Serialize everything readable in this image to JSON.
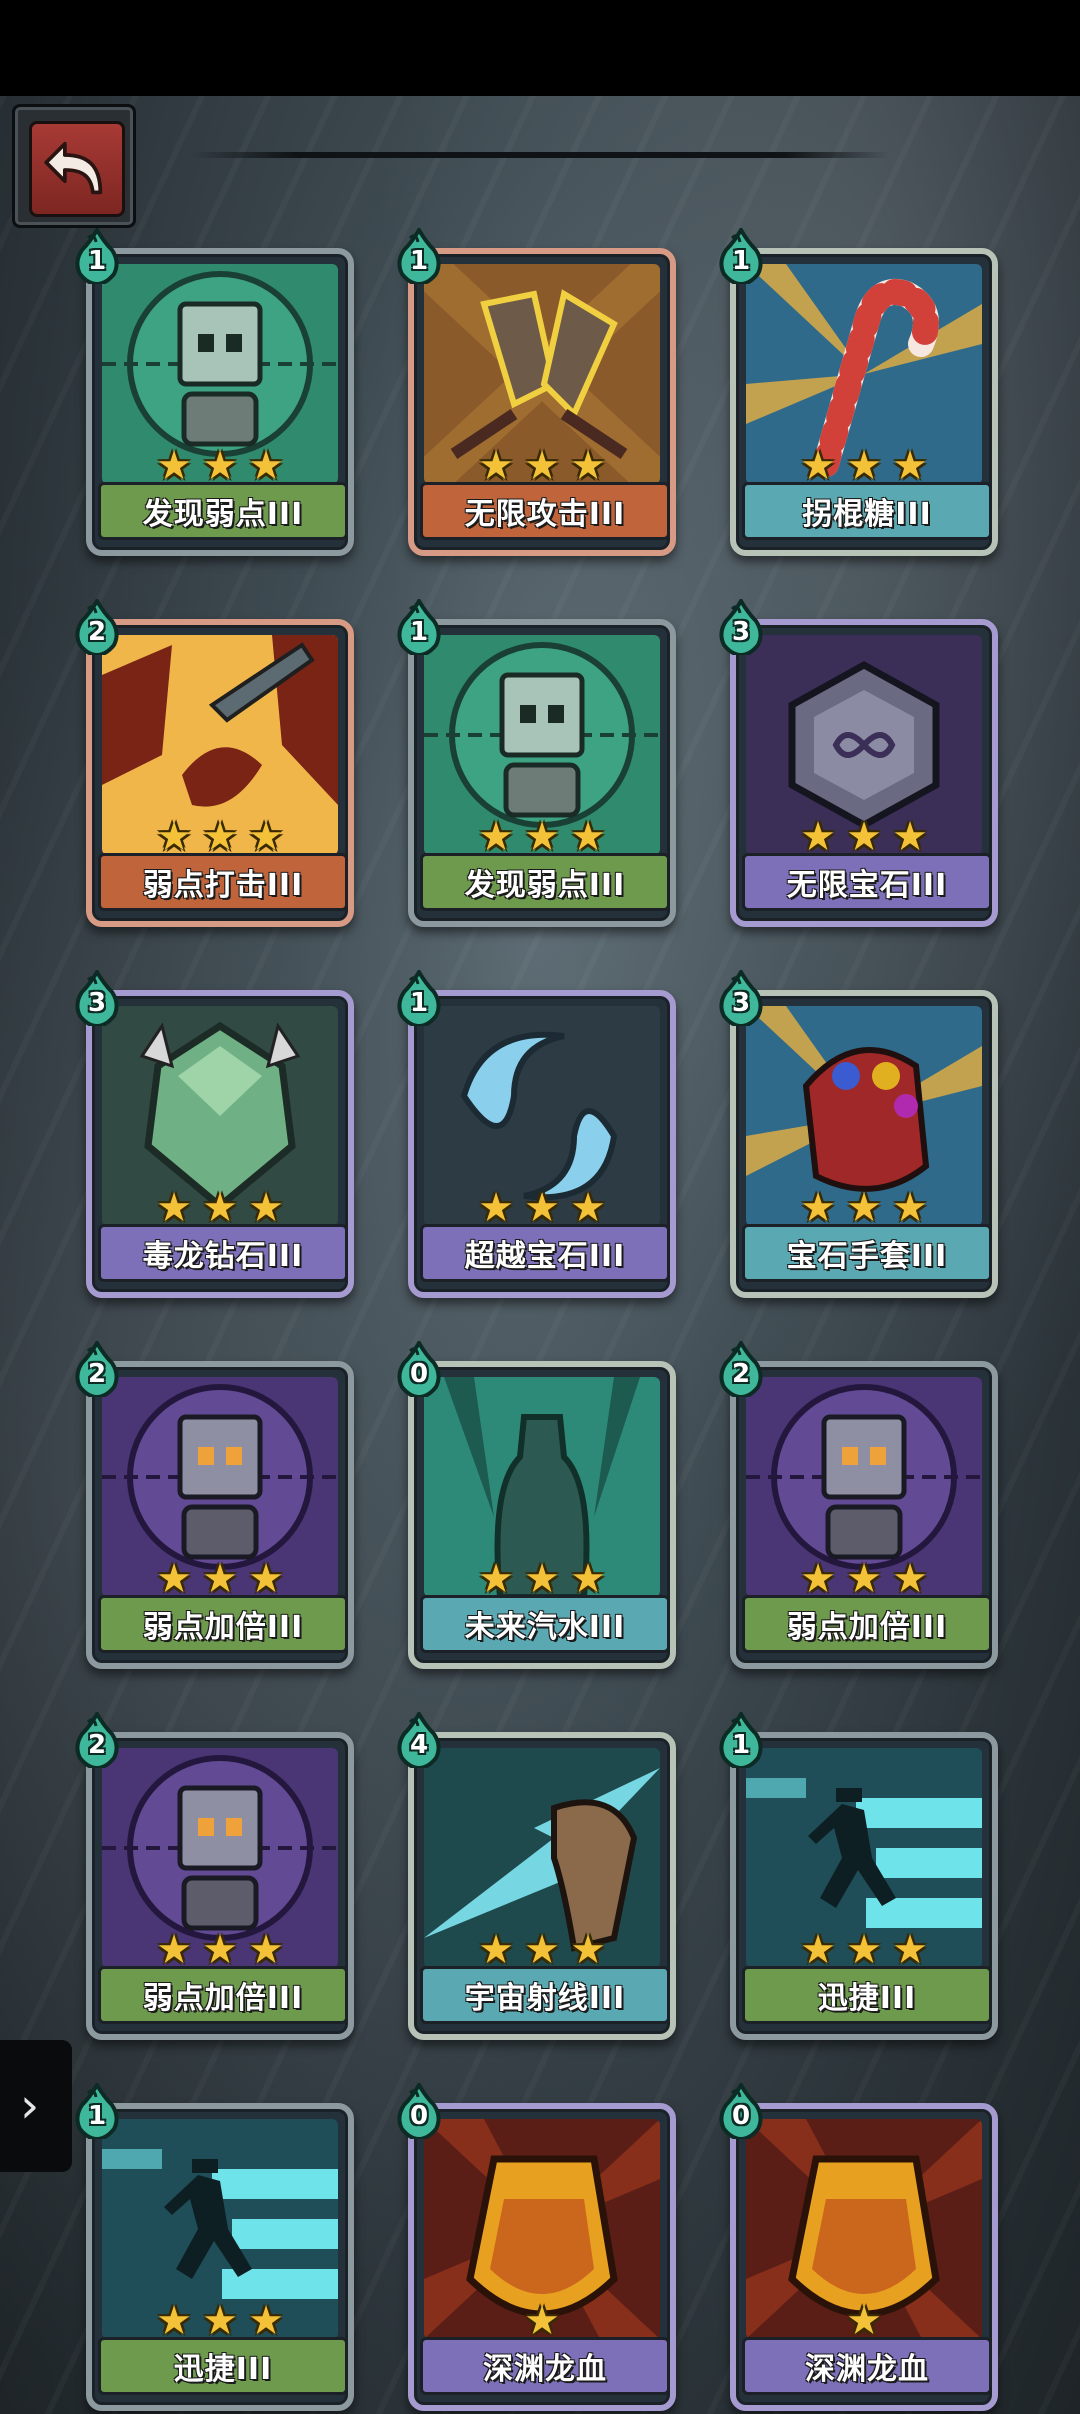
{
  "colors": {
    "green_banner": "#6e9a4d",
    "orange_banner": "#c0643c",
    "teal_banner": "#5aa8b2",
    "purple_banner": "#7d6fb8",
    "star": "#f3c238"
  },
  "navigation": {
    "back_icon": "back-arrow-icon",
    "side_icon": "chevron-right-icon"
  },
  "cards": [
    {
      "name": "发现弱点III",
      "cost": "1",
      "stars": 3,
      "type": "green",
      "icon": "target-robot-icon"
    },
    {
      "name": "无限攻击III",
      "cost": "1",
      "stars": 3,
      "type": "orange",
      "icon": "broken-swords-icon"
    },
    {
      "name": "拐棍糖III",
      "cost": "1",
      "stars": 3,
      "type": "teal",
      "icon": "candy-cane-icon"
    },
    {
      "name": "弱点打击III",
      "cost": "2",
      "stars": 3,
      "type": "orange",
      "icon": "dagger-strike-icon"
    },
    {
      "name": "发现弱点III",
      "cost": "1",
      "stars": 3,
      "type": "green",
      "icon": "target-robot-icon"
    },
    {
      "name": "无限宝石III",
      "cost": "3",
      "stars": 3,
      "type": "purple",
      "icon": "infinity-gem-icon"
    },
    {
      "name": "毒龙钻石III",
      "cost": "3",
      "stars": 3,
      "type": "purple",
      "icon": "dragon-diamond-icon"
    },
    {
      "name": "超越宝石III",
      "cost": "1",
      "stars": 3,
      "type": "purple",
      "icon": "twin-gems-icon"
    },
    {
      "name": "宝石手套III",
      "cost": "3",
      "stars": 3,
      "type": "teal",
      "icon": "gem-gauntlet-icon"
    },
    {
      "name": "弱点加倍III",
      "cost": "2",
      "stars": 3,
      "type": "green",
      "icon": "purple-robot-icon"
    },
    {
      "name": "未来汽水III",
      "cost": "0",
      "stars": 3,
      "type": "teal",
      "icon": "soda-bottle-icon"
    },
    {
      "name": "弱点加倍III",
      "cost": "2",
      "stars": 3,
      "type": "green",
      "icon": "purple-robot-icon"
    },
    {
      "name": "弱点加倍III",
      "cost": "2",
      "stars": 3,
      "type": "green",
      "icon": "purple-robot-icon"
    },
    {
      "name": "宇宙射线III",
      "cost": "4",
      "stars": 3,
      "type": "teal",
      "icon": "cosmic-ray-icon"
    },
    {
      "name": "迅捷III",
      "cost": "1",
      "stars": 3,
      "type": "green",
      "icon": "running-man-icon"
    },
    {
      "name": "迅捷III",
      "cost": "1",
      "stars": 3,
      "type": "green",
      "icon": "running-man-icon"
    },
    {
      "name": "深渊龙血",
      "cost": "0",
      "stars": 1,
      "type": "purple",
      "icon": "dragon-blood-flask-icon"
    },
    {
      "name": "深渊龙血",
      "cost": "0",
      "stars": 1,
      "type": "purple",
      "icon": "dragon-blood-flask-icon"
    }
  ]
}
